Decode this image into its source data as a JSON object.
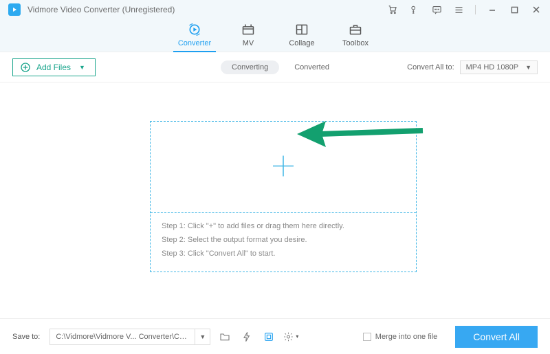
{
  "title": "Vidmore Video Converter (Unregistered)",
  "tabs": [
    {
      "label": "Converter",
      "active": true
    },
    {
      "label": "MV"
    },
    {
      "label": "Collage"
    },
    {
      "label": "Toolbox"
    }
  ],
  "toolbar": {
    "add_files": "Add Files",
    "mode_converting": "Converting",
    "mode_converted": "Converted",
    "convert_all_to": "Convert All to:",
    "format_selected": "MP4 HD 1080P"
  },
  "drop": {
    "step1": "Step 1: Click \"+\" to add files or drag them here directly.",
    "step2": "Step 2: Select the output format you desire.",
    "step3": "Step 3: Click \"Convert All\" to start."
  },
  "bottom": {
    "save_to": "Save to:",
    "path": "C:\\Vidmore\\Vidmore V... Converter\\Converted",
    "merge": "Merge into one file",
    "convert_all": "Convert All"
  }
}
